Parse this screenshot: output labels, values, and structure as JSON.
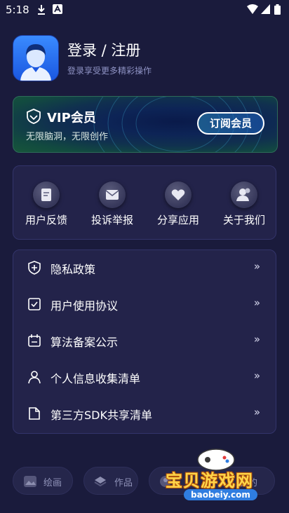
{
  "status_bar": {
    "time": "5:18"
  },
  "profile": {
    "title": "登录 / 注册",
    "subtitle": "登录享受更多精彩操作"
  },
  "vip": {
    "title": "VIP会员",
    "subtitle": "无限脑洞，无限创作",
    "button": "订阅会员"
  },
  "grid": {
    "items": [
      {
        "label": "用户反馈",
        "icon": "feedback-icon"
      },
      {
        "label": "投诉举报",
        "icon": "mail-icon"
      },
      {
        "label": "分享应用",
        "icon": "share-heart-icon"
      },
      {
        "label": "关于我们",
        "icon": "people-icon"
      }
    ]
  },
  "list": {
    "arrow": "»",
    "items": [
      {
        "label": "隐私政策",
        "icon": "shield-icon"
      },
      {
        "label": "用户使用协议",
        "icon": "doc-check-icon"
      },
      {
        "label": "算法备案公示",
        "icon": "calendar-icon"
      },
      {
        "label": "个人信息收集清单",
        "icon": "person-icon"
      },
      {
        "label": "第三方SDK共享清单",
        "icon": "file-icon"
      }
    ]
  },
  "tabs": [
    {
      "label": "绘画",
      "icon": "paint-icon"
    },
    {
      "label": "作品",
      "icon": "layers-icon"
    },
    {
      "label": "我的",
      "icon": "user-icon"
    }
  ],
  "watermark": {
    "text": "宝贝游戏网",
    "url": "baobeiy.com"
  },
  "colors": {
    "background": "#1a1b3c",
    "card": "#23234a",
    "accent_blue": "#2f7de0",
    "watermark_yellow": "#ffd54a"
  }
}
